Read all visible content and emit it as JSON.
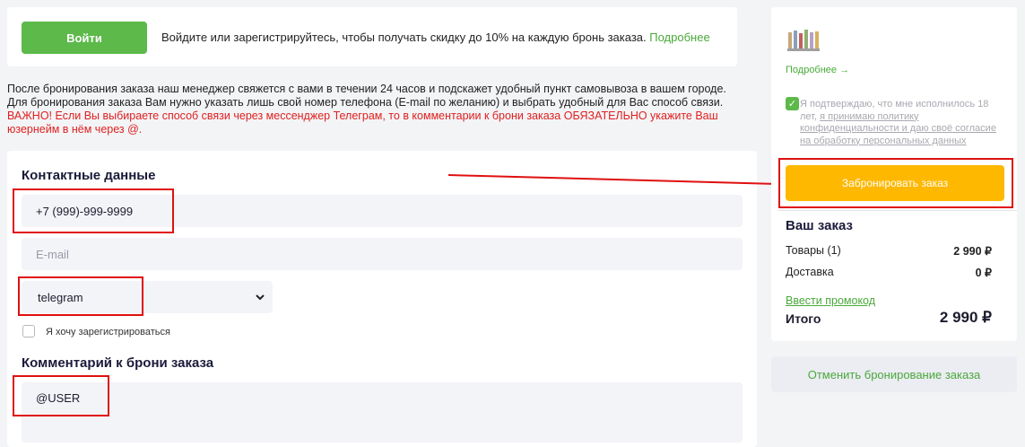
{
  "login": {
    "button_label": "Войти",
    "text": "Войдите или зарегистрируйтесь, чтобы получать скидку до 10% на каждую бронь заказа.",
    "link": "Подробнее"
  },
  "notice": {
    "line1": "После бронирования заказа наш менеджер свяжется с вами в течении 24 часов и подскажет удобный пункт самовывоза в вашем городе.",
    "line2": "Для бронирования заказа Вам нужно указать лишь свой номер телефона (E-mail по желанию) и выбрать удобный для Вас способ связи.",
    "warning": "ВАЖНО! Если Вы выбираете способ связи через мессенджер Телеграм, то в комментарии к брони заказа ОБЯЗАТЕЛЬНО укажите Ваш юзернейм в нём через @."
  },
  "contact": {
    "title": "Контактные данные",
    "phone_value": "+7 (999)-999-9999",
    "email_placeholder": "E-mail",
    "method_selected": "telegram",
    "register_label": "Я хочу зарегистрироваться"
  },
  "comment": {
    "title": "Комментарий к брони заказа",
    "value": "@USER"
  },
  "sidebar": {
    "more_link": "Подробнее →",
    "consent_prefix": "Я подтверждаю, что мне исполнилось 18 лет,",
    "consent_link1": "я принимаю политику конфиденциальности и даю своё согласие на обработку персональных данных",
    "book_button": "Забронировать заказ",
    "order_title": "Ваш заказ",
    "goods_label": "Товары (1)",
    "goods_value": "2 990 ₽",
    "delivery_label": "Доставка",
    "delivery_value": "0 ₽",
    "promo_link": "Ввести промокод",
    "total_label": "Итого",
    "total_value": "2 990 ₽",
    "cancel_button": "Отменить бронирование заказа"
  },
  "colors": {
    "green": "#5cb94a",
    "yellow": "#ffb800",
    "annotation_red": "#e01010"
  }
}
